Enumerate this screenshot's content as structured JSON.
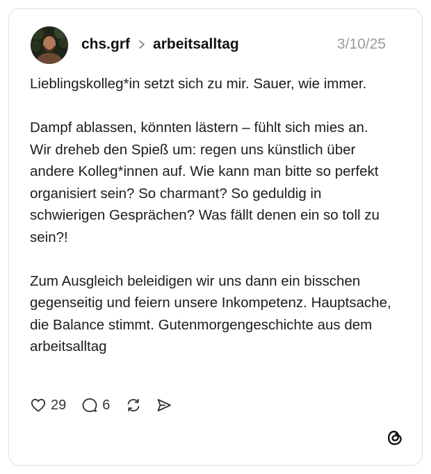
{
  "post": {
    "username": "chs.grf",
    "community": "arbeitsalltag",
    "date": "3/10/25",
    "paragraphs": [
      "Lieblingskolleg*in setzt sich zu mir. Sauer, wie immer.",
      "Dampf ablassen, könnten lästern – fühlt sich mies an. Wir dreheb den Spieß um: regen uns künstlich über andere Kolleg*innen auf. Wie kann man bitte so perfekt organisiert sein? So charmant? So geduldig in schwierigen Gesprächen? Was fällt denen ein so toll zu sein?!",
      "Zum Ausgleich beleidigen wir uns dann ein bisschen gegenseitig und feiern unsere Inkompetenz. Hauptsache, die Balance stimmt. Gutenmorgengeschichte aus dem arbeitsalltag"
    ]
  },
  "actions": {
    "likes": "29",
    "replies": "6"
  },
  "icons": {
    "like": "heart-icon",
    "reply": "speech-bubble-icon",
    "repost": "repost-icon",
    "share": "send-icon",
    "separator": "chevron-right-icon",
    "brand": "threads-logo-icon"
  },
  "colors": {
    "text": "#1c1c1c",
    "muted": "#999999",
    "border": "#e0e0e0"
  }
}
